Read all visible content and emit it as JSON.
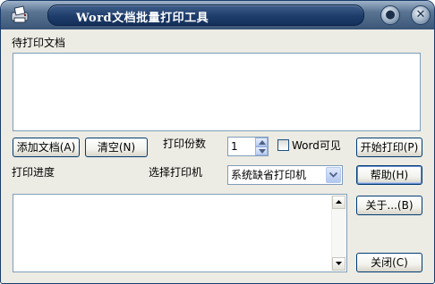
{
  "window": {
    "title": "Word文档批量打印工具"
  },
  "titlebar": {
    "min_glyph": "●",
    "close_glyph": "✕"
  },
  "pending": {
    "label": "待打印文档",
    "items": []
  },
  "buttons": {
    "add_docs": "添加文档(A)",
    "clear": "清空(N)",
    "start_print": "开始打印(P)",
    "help": "帮助(H)",
    "about": "关于...(B)",
    "close": "关闭(C)"
  },
  "copies": {
    "label": "打印份数",
    "value": "1"
  },
  "word_visible": {
    "label": "Word可见",
    "checked": false
  },
  "progress": {
    "label": "打印进度",
    "items": []
  },
  "printer": {
    "label": "选择打印机",
    "selected": "系统缺省打印机"
  },
  "colors": {
    "title_bar": "#3b5677",
    "title_text": "#ffffff",
    "face": "#ecebe4",
    "field_border": "#7f9db9"
  }
}
